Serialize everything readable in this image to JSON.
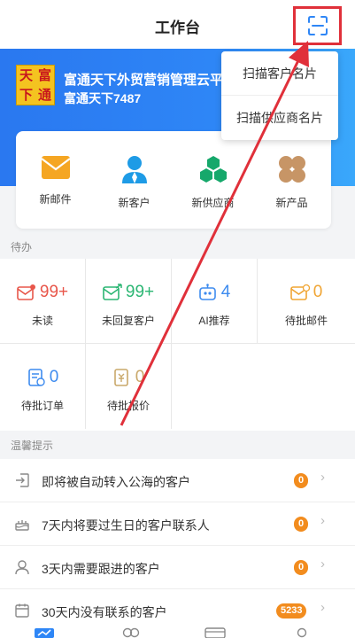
{
  "header": {
    "title": "工作台",
    "scan_icon": "scan-icon"
  },
  "banner": {
    "logo_chars": [
      "天",
      "富",
      "下",
      "通"
    ],
    "company_name": "富通天下外贸营销管理云平",
    "company_sub": "富通天下7487"
  },
  "quick_actions": [
    {
      "label": "新邮件",
      "icon": "mail-icon"
    },
    {
      "label": "新客户",
      "icon": "person-icon"
    },
    {
      "label": "新供应商",
      "icon": "supplier-icon"
    },
    {
      "label": "新产品",
      "icon": "product-icon"
    }
  ],
  "dropdown": {
    "items": [
      "扫描客户名片",
      "扫描供应商名片"
    ]
  },
  "todo": {
    "section_label": "待办",
    "items": [
      {
        "count": "99+",
        "label": "未读",
        "color": "#e8564a"
      },
      {
        "count": "99+",
        "label": "未回复客户",
        "color": "#2bb673"
      },
      {
        "count": "4",
        "label": "AI推荐",
        "color": "#3d8bef"
      },
      {
        "count": "0",
        "label": "待批邮件",
        "color": "#f0a534"
      },
      {
        "count": "0",
        "label": "待批订单",
        "color": "#3d8bef"
      },
      {
        "count": "0",
        "label": "待批报价",
        "color": "#c9a86a"
      }
    ]
  },
  "tips": {
    "section_label": "温馨提示",
    "items": [
      {
        "text": "即将被自动转入公海的客户",
        "badge": "0",
        "icon": "transfer-icon"
      },
      {
        "text": "7天内将要过生日的客户联系人",
        "badge": "0",
        "icon": "cake-icon"
      },
      {
        "text": "3天内需要跟进的客户",
        "badge": "0",
        "icon": "user-icon"
      },
      {
        "text": "30天内没有联系的客户",
        "badge": "5233",
        "icon": "calendar-icon"
      }
    ]
  },
  "colors": {
    "accent": "#2e86f6",
    "highlight_box": "#e0303a",
    "badge": "#f28c1e"
  }
}
